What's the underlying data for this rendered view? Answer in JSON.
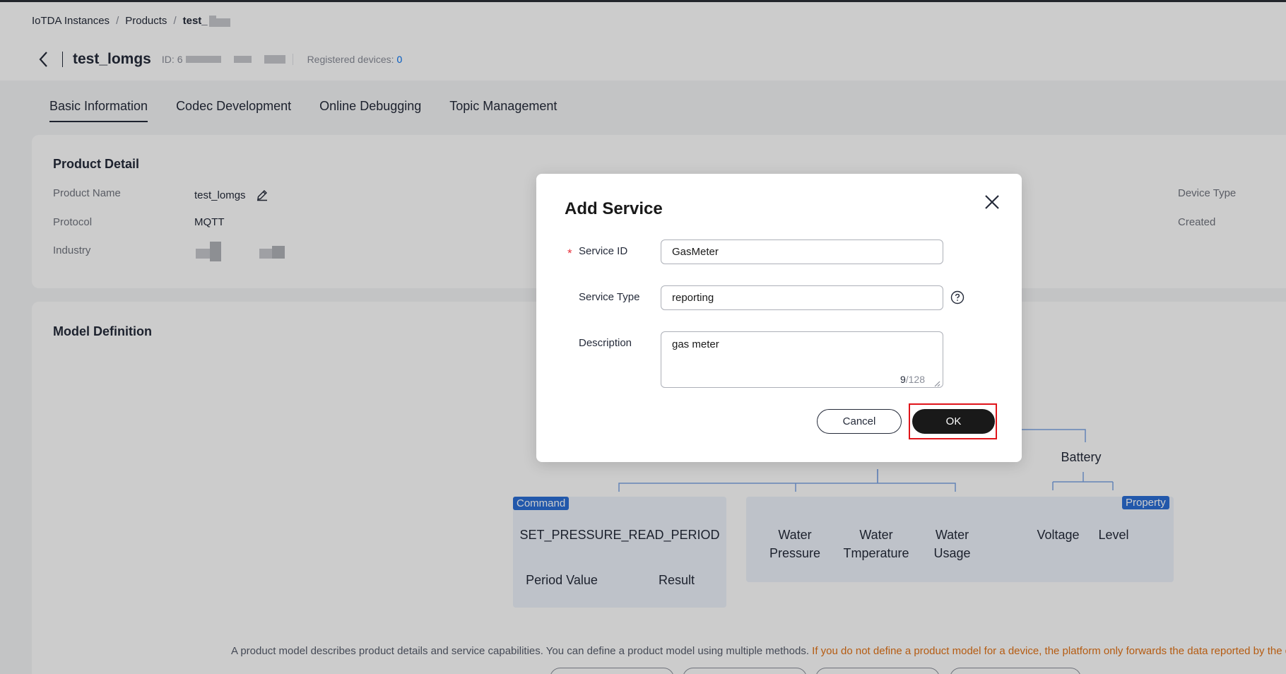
{
  "breadcrumb": {
    "items": [
      "IoTDA Instances",
      "Products"
    ],
    "current": "test_",
    "separator": "/"
  },
  "product": {
    "title": "test_lomgs",
    "id_label": "ID:",
    "id_prefix": "6",
    "registered_label": "Registered devices:",
    "registered_count": "0"
  },
  "tabs": [
    {
      "label": "Basic Information",
      "active": true
    },
    {
      "label": "Codec Development"
    },
    {
      "label": "Online Debugging"
    },
    {
      "label": "Topic Management"
    }
  ],
  "product_detail": {
    "title": "Product Detail",
    "fields": {
      "name_label": "Product Name",
      "name_value": "test_lomgs",
      "protocol_label": "Protocol",
      "protocol_value": "MQTT",
      "industry_label": "Industry",
      "device_type_label": "Device Type",
      "created_label": "Created"
    }
  },
  "model_definition": {
    "title": "Model Definition",
    "tree": {
      "command_tag": "Command",
      "property_tag": "Property",
      "command": "SET_PRESSURE_READ_PERIOD",
      "command_params": [
        "Period Value",
        "Result"
      ],
      "properties": [
        [
          "Water",
          "Pressure"
        ],
        [
          "Water",
          "Tmperature"
        ],
        [
          "Water",
          "Usage"
        ]
      ],
      "battery": "Battery",
      "battery_props": [
        "Voltage",
        "Level"
      ]
    },
    "description": "A product model describes product details and service capabilities. You can define a product model using multiple methods.",
    "warning": "If you do not define a product model for a device, the platform only forwards the data reported by the d"
  },
  "modal": {
    "title": "Add Service",
    "service_id_label": "Service ID",
    "service_id_value": "GasMeter",
    "service_type_label": "Service Type",
    "service_type_value": "reporting",
    "description_label": "Description",
    "description_value": "gas meter",
    "char_count": "9",
    "char_max": "/128",
    "cancel_label": "Cancel",
    "ok_label": "OK"
  },
  "colors": {
    "accent": "#0070f2",
    "tag_blue": "#2b6fd6",
    "warning": "#e37317",
    "highlight_red": "#e0141a",
    "primary_button": "#191919"
  },
  "icons": [
    "back-arrow-icon",
    "edit-pencil-icon",
    "close-icon",
    "help-circle-icon",
    "resize-grip-icon"
  ]
}
